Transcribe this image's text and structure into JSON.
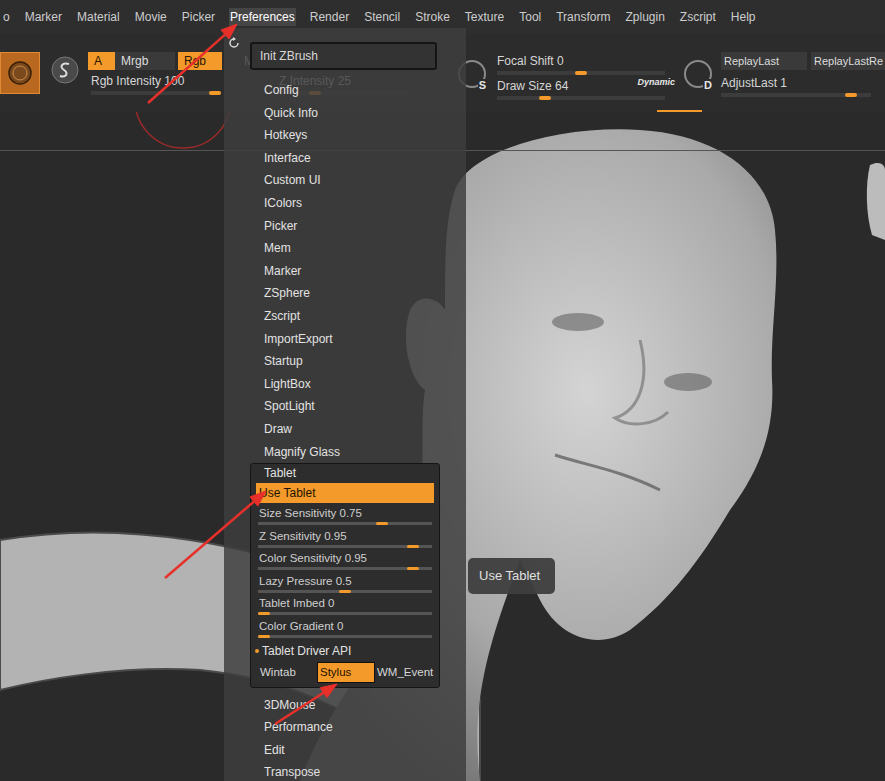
{
  "menu_bar": {
    "items": [
      {
        "label": "o",
        "selected": false
      },
      {
        "label": "Marker",
        "selected": false
      },
      {
        "label": "Material",
        "selected": false
      },
      {
        "label": "Movie",
        "selected": false
      },
      {
        "label": "Picker",
        "selected": false
      },
      {
        "label": "Preferences",
        "selected": true
      },
      {
        "label": "Render",
        "selected": false
      },
      {
        "label": "Stencil",
        "selected": false
      },
      {
        "label": "Stroke",
        "selected": false
      },
      {
        "label": "Texture",
        "selected": false
      },
      {
        "label": "Tool",
        "selected": false
      },
      {
        "label": "Transform",
        "selected": false
      },
      {
        "label": "Zplugin",
        "selected": false
      },
      {
        "label": "Zscript",
        "selected": false
      },
      {
        "label": "Help",
        "selected": false
      }
    ]
  },
  "toolbar": {
    "color_buttons": [
      {
        "label": "A",
        "selected": true
      },
      {
        "label": "Mrgb",
        "selected": false
      },
      {
        "label": "Rgb",
        "selected": true
      },
      {
        "label": "M",
        "selected": false
      }
    ],
    "color_sliders": [
      {
        "label": "Rgb Intensity 100",
        "level": 1.0
      },
      {
        "label": "Z Intensity 25",
        "level": 0.25
      }
    ],
    "draw_group": {
      "badge": "S",
      "sliders": [
        {
          "label": "Focal Shift 0",
          "level": 0.5
        },
        {
          "label": "Draw Size 64",
          "level": 0.27
        }
      ],
      "mode": "Dynamic"
    },
    "replay_group": {
      "badge": "D",
      "buttons": [
        "ReplayLast",
        "ReplayLastRe"
      ],
      "sliders": [
        {
          "label": "AdjustLast 1",
          "level": 0.9
        }
      ]
    }
  },
  "preferences_menu": {
    "init_button": "Init ZBrush",
    "items_above": [
      "Config",
      "Quick Info",
      "Hotkeys",
      "Interface",
      "Custom UI",
      "IColors",
      "Picker",
      "Mem",
      "Marker",
      "ZSphere",
      "Zscript",
      "ImportExport",
      "Startup",
      "LightBox",
      "SpotLight",
      "Draw",
      "Magnify Glass"
    ],
    "tablet": {
      "title": "Tablet",
      "expanded": true,
      "use_tablet": {
        "label": "Use Tablet",
        "on": true
      },
      "sliders": [
        {
          "label": "Size Sensitivity 0.75",
          "level": 0.73
        },
        {
          "label": "Z Sensitivity 0.95",
          "level": 0.92
        },
        {
          "label": "Color Sensitivity 0.95",
          "level": 0.92
        },
        {
          "label": "Lazy Pressure 0.5",
          "level": 0.5
        },
        {
          "label": "Tablet Imbed 0",
          "level": 0.0
        },
        {
          "label": "Color Gradient 0",
          "level": 0.0
        }
      ],
      "driver": {
        "label": "Tablet Driver API",
        "options": [
          {
            "label": "Wintab",
            "selected": false
          },
          {
            "label": "Stylus",
            "selected": true
          },
          {
            "label": "WM_Event",
            "selected": false
          }
        ]
      }
    },
    "items_below": [
      "3DMouse",
      "Performance",
      "Edit",
      "Transpose"
    ]
  },
  "tooltip": "Use Tablet"
}
